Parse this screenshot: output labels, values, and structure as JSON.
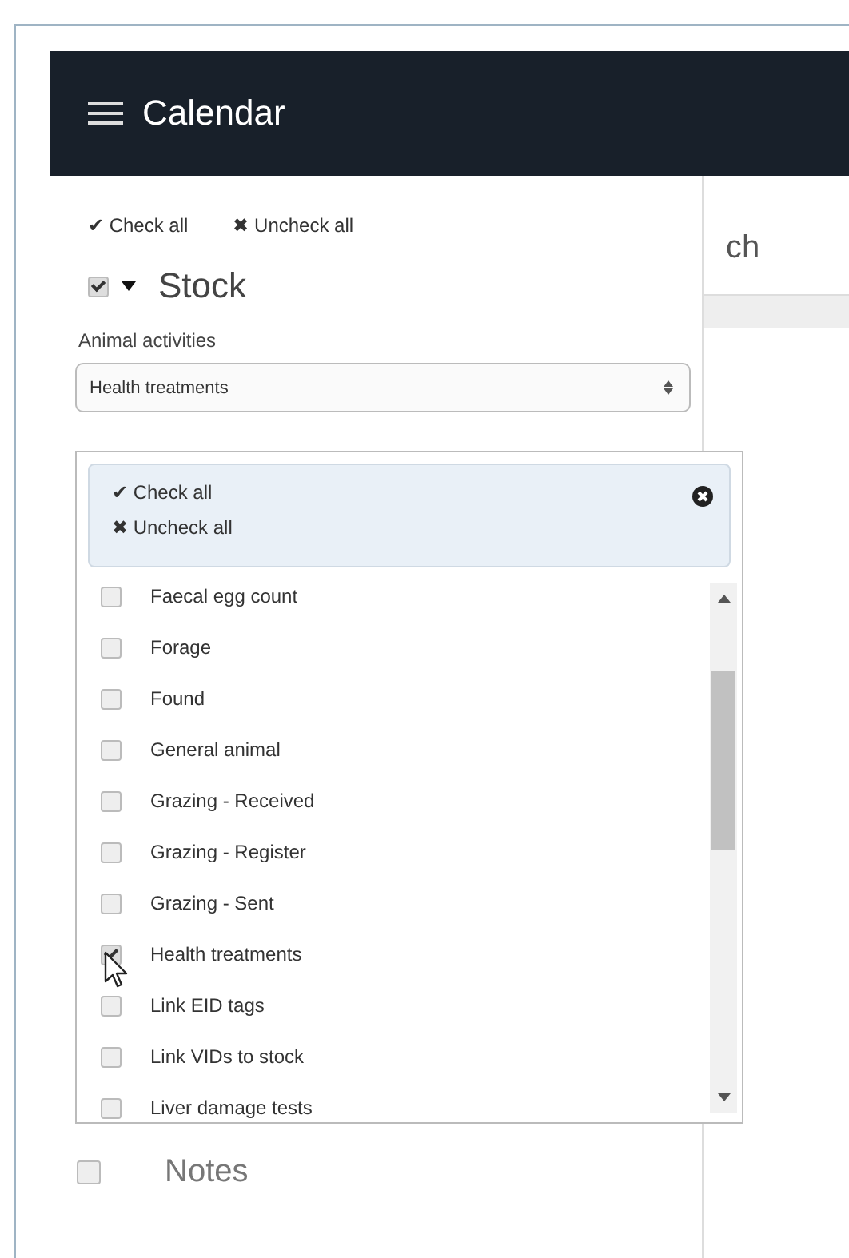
{
  "header": {
    "title": "Calendar"
  },
  "toolbar": {
    "check_all": "✔ Check all",
    "uncheck_all": "✖ Uncheck all"
  },
  "stock": {
    "label": "Stock",
    "checked": true,
    "expanded": true,
    "field_label": "Animal activities",
    "select_value": "Health treatments"
  },
  "popup": {
    "check_all": "✔ Check all",
    "uncheck_all": "✖ Uncheck all",
    "options": [
      {
        "label": "Faecal egg count",
        "checked": false
      },
      {
        "label": "Forage",
        "checked": false
      },
      {
        "label": "Found",
        "checked": false
      },
      {
        "label": "General animal",
        "checked": false
      },
      {
        "label": "Grazing - Received",
        "checked": false
      },
      {
        "label": "Grazing - Register",
        "checked": false
      },
      {
        "label": "Grazing - Sent",
        "checked": false
      },
      {
        "label": "Health treatments",
        "checked": true
      },
      {
        "label": "Link EID tags",
        "checked": false
      },
      {
        "label": "Link VIDs to stock",
        "checked": false
      },
      {
        "label": "Liver damage tests",
        "checked": false
      }
    ]
  },
  "notes": {
    "label": "Notes",
    "checked": false
  },
  "content": {
    "heading_fragment": "ch"
  }
}
